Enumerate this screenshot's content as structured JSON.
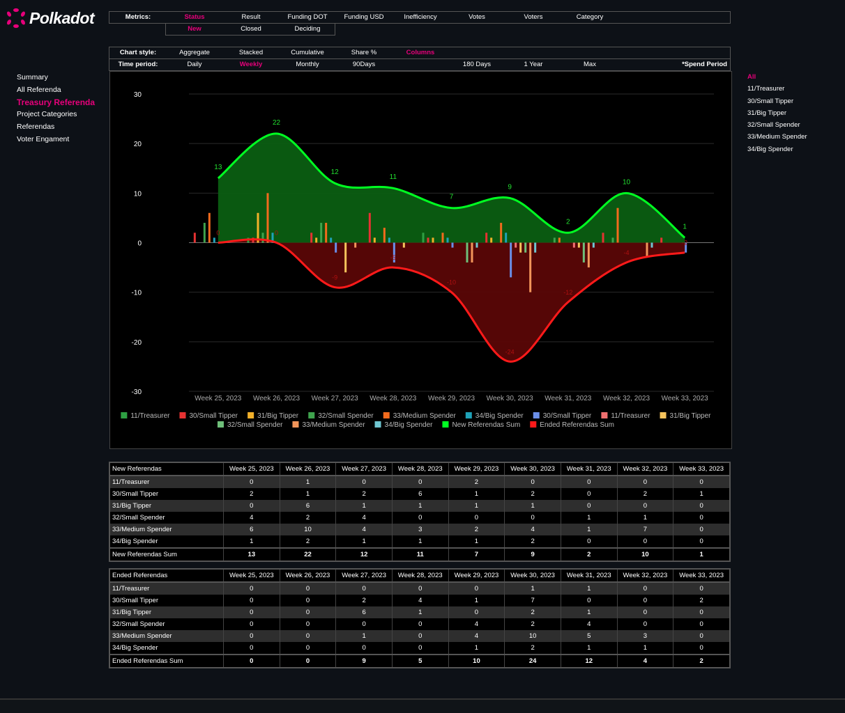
{
  "brand": {
    "name": "Polkadot"
  },
  "metrics_bar": {
    "label": "Metrics:",
    "items": [
      "Status",
      "Result",
      "Funding DOT",
      "Funding USD",
      "Inefficiency",
      "Votes",
      "Voters",
      "Category"
    ],
    "active": "Status",
    "sub_items": [
      "New",
      "Closed",
      "Deciding"
    ],
    "sub_active": "New"
  },
  "chart_style_bar": {
    "label": "Chart style:",
    "items": [
      "Aggregate",
      "Stacked",
      "Cumulative",
      "Share %",
      "Columns"
    ],
    "active": "Columns"
  },
  "time_period_bar": {
    "label": "Time period:",
    "items": [
      "Daily",
      "Weekly",
      "Monthly",
      "90Days",
      "180 Days",
      "1 Year",
      "Max"
    ],
    "active": "Weekly",
    "spend_period": "*Spend Period"
  },
  "left_nav": [
    "Summary",
    "All Referenda",
    "Treasury Referenda",
    "Project Categories",
    "Referendas",
    "Voter Engament"
  ],
  "left_nav_active": "Treasury Referenda",
  "right_nav": [
    "All",
    "11/Treasurer",
    "30/Small Tipper",
    "31/Big Tipper",
    "32/Small Spender",
    "33/Medium Spender",
    "34/Big Spender"
  ],
  "right_nav_active": "All",
  "colors": {
    "accent": "#e6007a",
    "new_sum_line": "#00ff22",
    "new_sum_fill": "#0b5e12",
    "ended_sum_line": "#ff1a1a",
    "ended_sum_fill": "#5a0606"
  },
  "chart_data": {
    "type": "bar",
    "categories": [
      "Week 25, 2023",
      "Week 26, 2023",
      "Week 27, 2023",
      "Week 28, 2023",
      "Week 29, 2023",
      "Week 30, 2023",
      "Week 31, 2023",
      "Week 32, 2023",
      "Week 33, 2023"
    ],
    "ylim": [
      -30,
      30
    ],
    "yticks": [
      30,
      20,
      10,
      0,
      -10,
      -20,
      -30
    ],
    "grid": true,
    "legend_position": "bottom",
    "series": [
      {
        "name": "11/Treasurer",
        "group": "new",
        "color": "#2ea043",
        "values": [
          0,
          1,
          0,
          0,
          2,
          0,
          0,
          0,
          0
        ]
      },
      {
        "name": "30/Small Tipper",
        "group": "new",
        "color": "#e63232",
        "values": [
          2,
          1,
          2,
          6,
          1,
          2,
          0,
          2,
          1
        ]
      },
      {
        "name": "31/Big Tipper",
        "group": "new",
        "color": "#f2b02a",
        "values": [
          0,
          6,
          1,
          1,
          1,
          1,
          0,
          0,
          0
        ]
      },
      {
        "name": "32/Small Spender",
        "group": "new",
        "color": "#3fa34d",
        "values": [
          4,
          2,
          4,
          0,
          0,
          0,
          1,
          1,
          0
        ]
      },
      {
        "name": "33/Medium Spender",
        "group": "new",
        "color": "#f26b1d",
        "values": [
          6,
          10,
          4,
          3,
          2,
          4,
          1,
          7,
          0
        ]
      },
      {
        "name": "34/Big Spender",
        "group": "new",
        "color": "#1fa2b8",
        "values": [
          1,
          2,
          1,
          1,
          1,
          2,
          0,
          0,
          0
        ]
      },
      {
        "name": "30/Small Tipper",
        "group": "ended",
        "color": "#6b8fe8",
        "values": [
          0,
          0,
          2,
          4,
          1,
          7,
          0,
          0,
          2
        ]
      },
      {
        "name": "11/Treasurer",
        "group": "ended",
        "color": "#f07070",
        "values": [
          0,
          0,
          0,
          0,
          0,
          1,
          1,
          0,
          0
        ]
      },
      {
        "name": "31/Big Tipper",
        "group": "ended",
        "color": "#f5c35c",
        "values": [
          0,
          0,
          6,
          1,
          0,
          2,
          1,
          0,
          0
        ]
      },
      {
        "name": "32/Small Spender",
        "group": "ended",
        "color": "#6fbf7a",
        "values": [
          0,
          0,
          0,
          0,
          4,
          2,
          4,
          0,
          0
        ]
      },
      {
        "name": "33/Medium Spender",
        "group": "ended",
        "color": "#f2955a",
        "values": [
          0,
          0,
          1,
          0,
          4,
          10,
          5,
          3,
          0
        ]
      },
      {
        "name": "34/Big Spender",
        "group": "ended",
        "color": "#6fc6d1",
        "values": [
          0,
          0,
          0,
          0,
          1,
          2,
          1,
          1,
          0
        ]
      },
      {
        "name": "New Referendas Sum",
        "type": "area",
        "color": "#00ff22",
        "values": [
          13,
          22,
          12,
          11,
          7,
          9,
          2,
          10,
          1
        ]
      },
      {
        "name": "Ended Referendas Sum",
        "type": "area",
        "color": "#ff1a1a",
        "values": [
          0,
          0,
          9,
          5,
          10,
          24,
          12,
          4,
          2
        ]
      }
    ]
  },
  "new_table": {
    "title": "New Referendas",
    "columns": [
      "Week 25, 2023",
      "Week 26, 2023",
      "Week 27, 2023",
      "Week 28, 2023",
      "Week 29, 2023",
      "Week 30, 2023",
      "Week 31, 2023",
      "Week 32, 2023",
      "Week 33, 2023"
    ],
    "rows": [
      {
        "label": "11/Treasurer",
        "values": [
          "0",
          "1",
          "0",
          "0",
          "2",
          "0",
          "0",
          "0",
          "0"
        ]
      },
      {
        "label": "30/Small Tipper",
        "values": [
          "2",
          "1",
          "2",
          "6",
          "1",
          "2",
          "0",
          "2",
          "1"
        ]
      },
      {
        "label": "31/Big Tipper",
        "values": [
          "0",
          "6",
          "1",
          "1",
          "1",
          "1",
          "0",
          "0",
          "0"
        ]
      },
      {
        "label": "32/Small Spender",
        "values": [
          "4",
          "2",
          "4",
          "0",
          "0",
          "0",
          "1",
          "1",
          "0"
        ]
      },
      {
        "label": "33/Medium Spender",
        "values": [
          "6",
          "10",
          "4",
          "3",
          "2",
          "4",
          "1",
          "7",
          "0"
        ]
      },
      {
        "label": "34/Big Spender",
        "values": [
          "1",
          "2",
          "1",
          "1",
          "1",
          "2",
          "0",
          "0",
          "0"
        ]
      }
    ],
    "sum": {
      "label": "New Referendas Sum",
      "values": [
        "13",
        "22",
        "12",
        "11",
        "7",
        "9",
        "2",
        "10",
        "1"
      ]
    }
  },
  "ended_table": {
    "title": "Ended Referendas",
    "columns": [
      "Week 25, 2023",
      "Week 26, 2023",
      "Week 27, 2023",
      "Week 28, 2023",
      "Week 29, 2023",
      "Week 30, 2023",
      "Week 31, 2023",
      "Week 32, 2023",
      "Week 33, 2023"
    ],
    "rows": [
      {
        "label": "11/Treasurer",
        "values": [
          "0",
          "0",
          "0",
          "0",
          "0",
          "1",
          "1",
          "0",
          "0"
        ]
      },
      {
        "label": "30/Small Tipper",
        "values": [
          "0",
          "0",
          "2",
          "4",
          "1",
          "7",
          "0",
          "0",
          "2"
        ]
      },
      {
        "label": "31/Big Tipper",
        "values": [
          "0",
          "0",
          "6",
          "1",
          "0",
          "2",
          "1",
          "0",
          "0"
        ]
      },
      {
        "label": "32/Small Spender",
        "values": [
          "0",
          "0",
          "0",
          "0",
          "4",
          "2",
          "4",
          "0",
          "0"
        ]
      },
      {
        "label": "33/Medium Spender",
        "values": [
          "0",
          "0",
          "1",
          "0",
          "4",
          "10",
          "5",
          "3",
          "0"
        ]
      },
      {
        "label": "34/Big Spender",
        "values": [
          "0",
          "0",
          "0",
          "0",
          "1",
          "2",
          "1",
          "1",
          "0"
        ]
      }
    ],
    "sum": {
      "label": "Ended Referendas Sum",
      "values": [
        "0",
        "0",
        "9",
        "5",
        "10",
        "24",
        "12",
        "4",
        "2"
      ]
    }
  }
}
